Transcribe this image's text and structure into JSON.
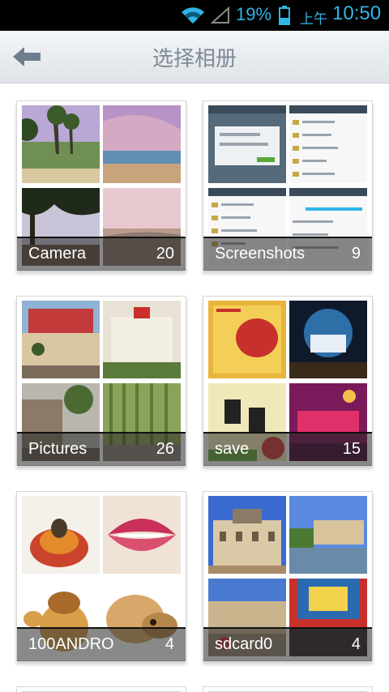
{
  "status_bar": {
    "battery_percent": "19%",
    "ampm": "上午",
    "time": "10:50",
    "icons": [
      "wifi-icon",
      "signal-icon",
      "battery-icon"
    ],
    "accent_color": "#2fb5e6"
  },
  "header": {
    "title": "选择相册",
    "back_icon": "back-arrow-icon"
  },
  "albums": [
    {
      "name": "Camera",
      "count": "20"
    },
    {
      "name": "Screenshots",
      "count": "9"
    },
    {
      "name": "Pictures",
      "count": "26"
    },
    {
      "name": "save",
      "count": "15"
    },
    {
      "name": "100ANDRO",
      "count": "4"
    },
    {
      "name": "sdcard0",
      "count": "4"
    }
  ]
}
